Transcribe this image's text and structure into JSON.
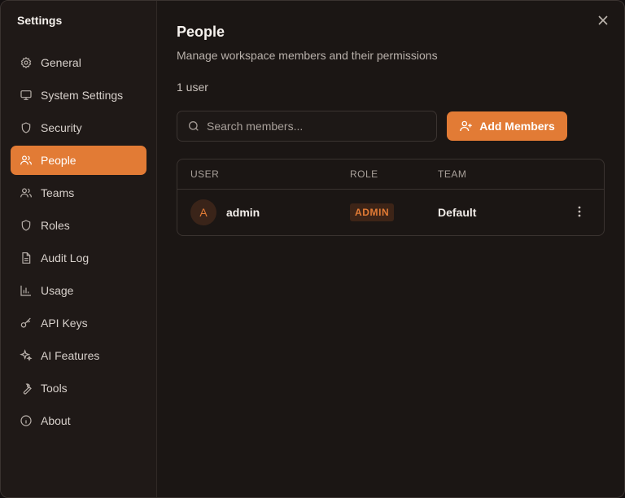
{
  "sidebar": {
    "title": "Settings",
    "items": [
      {
        "label": "General",
        "icon": "gear-icon"
      },
      {
        "label": "System Settings",
        "icon": "monitor-icon"
      },
      {
        "label": "Security",
        "icon": "shield-icon"
      },
      {
        "label": "People",
        "icon": "people-icon",
        "active": true
      },
      {
        "label": "Teams",
        "icon": "teams-icon"
      },
      {
        "label": "Roles",
        "icon": "shield-icon"
      },
      {
        "label": "Audit Log",
        "icon": "document-icon"
      },
      {
        "label": "Usage",
        "icon": "bar-chart-icon"
      },
      {
        "label": "API Keys",
        "icon": "key-icon"
      },
      {
        "label": "AI Features",
        "icon": "sparkles-icon"
      },
      {
        "label": "Tools",
        "icon": "wrench-icon"
      },
      {
        "label": "About",
        "icon": "info-icon"
      }
    ]
  },
  "main": {
    "title": "People",
    "subtitle": "Manage workspace members and their permissions",
    "count": "1 user",
    "search_placeholder": "Search members...",
    "add_button": "Add Members",
    "table": {
      "headers": [
        "USER",
        "ROLE",
        "TEAM"
      ],
      "rows": [
        {
          "avatar": "A",
          "name": "admin",
          "role": "ADMIN",
          "team": "Default"
        }
      ]
    }
  },
  "colors": {
    "accent": "#e27b35",
    "background": "#1b1614",
    "sidebar": "#1f1917"
  }
}
